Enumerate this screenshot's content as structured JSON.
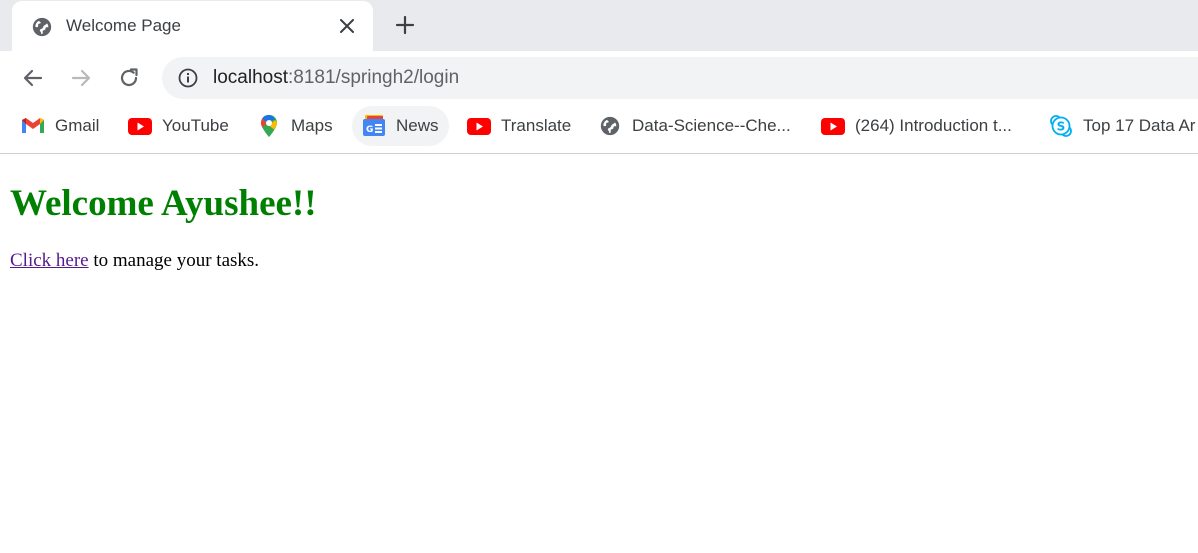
{
  "browser": {
    "tab": {
      "title": "Welcome Page",
      "favicon": "globe-icon"
    },
    "new_tab_icon": "plus-icon",
    "close_icon": "close-icon",
    "nav": {
      "back_icon": "arrow-left-icon",
      "forward_icon": "arrow-right-icon",
      "reload_icon": "reload-icon"
    },
    "address": {
      "icon": "info-icon",
      "host": "localhost",
      "rest": ":8181/springh2/login"
    },
    "bookmarks": [
      {
        "label": "Gmail",
        "icon": "gmail-icon"
      },
      {
        "label": "YouTube",
        "icon": "youtube-icon"
      },
      {
        "label": "Maps",
        "icon": "maps-pin-icon"
      },
      {
        "label": "News",
        "icon": "google-news-icon"
      },
      {
        "label": "Translate",
        "icon": "youtube-icon"
      },
      {
        "label": "Data-Science--Che...",
        "icon": "globe-icon"
      },
      {
        "label": "(264) Introduction t...",
        "icon": "youtube-icon"
      },
      {
        "label": "Top 17 Data Ar",
        "icon": "skype-icon"
      }
    ]
  },
  "page": {
    "heading": "Welcome Ayushee!!",
    "link_text": "Click here",
    "body_text": " to manage your tasks."
  },
  "colors": {
    "heading": "#008000",
    "visited_link": "#551a8b",
    "tabstrip_bg": "#e8eaed",
    "omnibox_bg": "#f1f3f4",
    "youtube_red": "#ff0000"
  }
}
